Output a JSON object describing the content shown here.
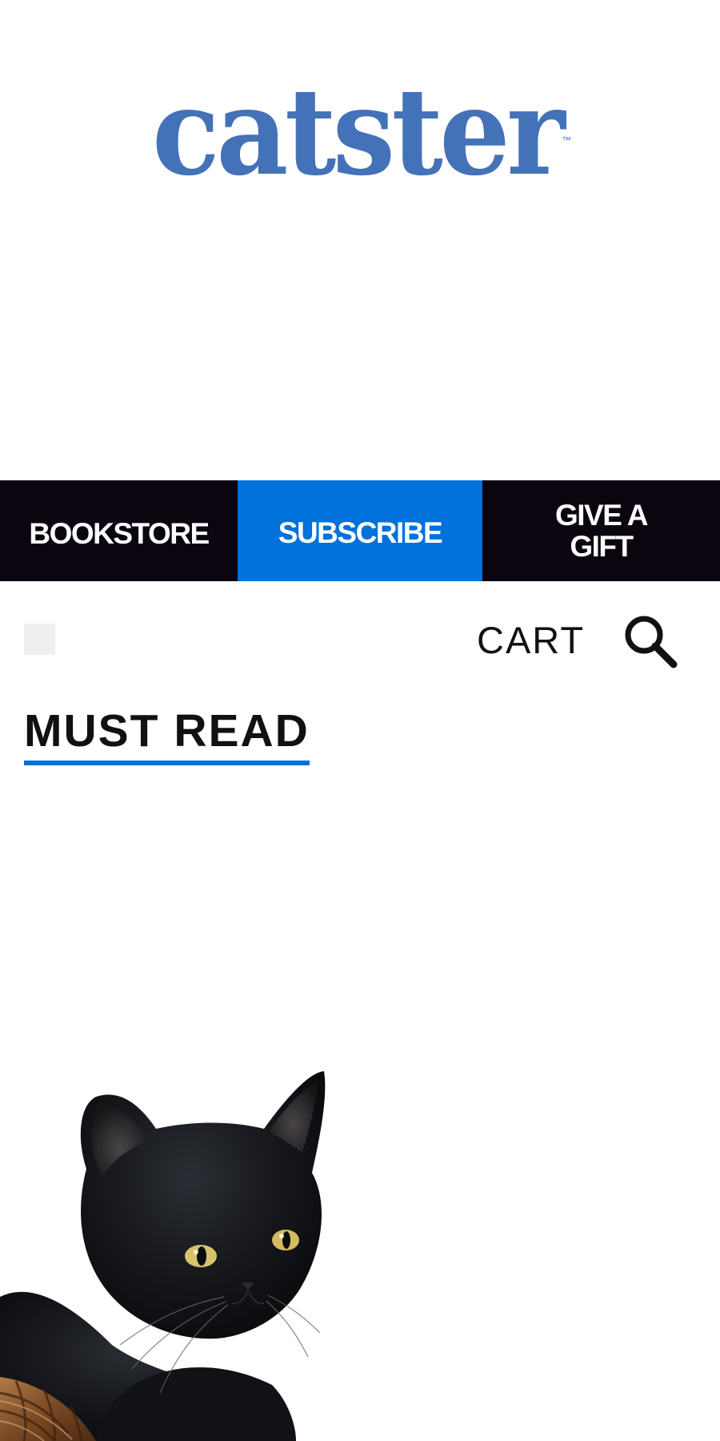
{
  "brand": {
    "logo_text": "catster",
    "trademark": "™",
    "color": "#4472b8"
  },
  "topnav": {
    "bookstore_label": "BOOKSTORE",
    "subscribe_label": "SUBSCRIBE",
    "gift_label": "GIVE A GIFT",
    "colors": {
      "dark": "#0b0510",
      "accent": "#0171dc"
    }
  },
  "utility": {
    "cart_label": "CART",
    "search_icon": "search-icon",
    "menu_icon": "menu-placeholder"
  },
  "section": {
    "title": "MUST READ",
    "underline_color": "#0171dc"
  },
  "feature": {
    "image_subject": "black-kitten-in-wicker-basket"
  }
}
